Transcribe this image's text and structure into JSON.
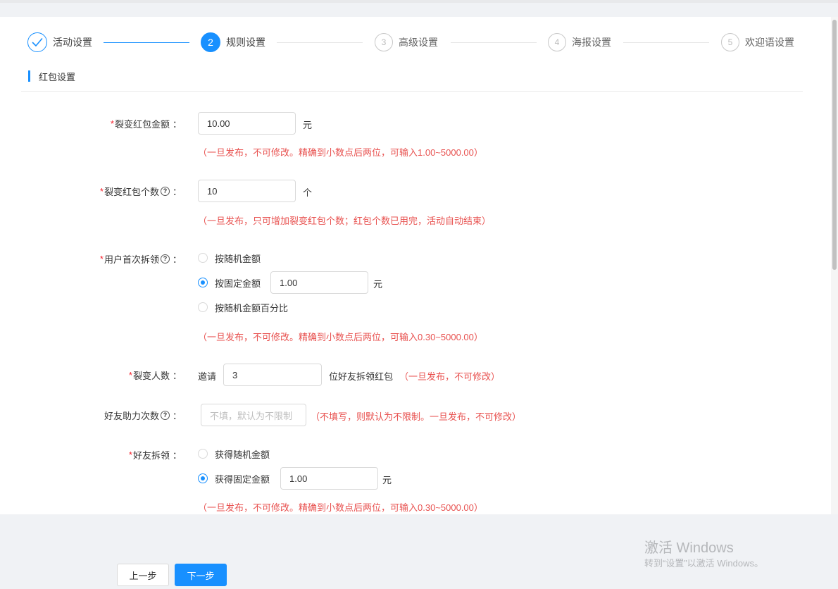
{
  "steps": [
    {
      "number": "1",
      "label": "活动设置",
      "state": "done"
    },
    {
      "number": "2",
      "label": "规则设置",
      "state": "active"
    },
    {
      "number": "3",
      "label": "高级设置",
      "state": "pending"
    },
    {
      "number": "4",
      "label": "海报设置",
      "state": "pending"
    },
    {
      "number": "5",
      "label": "欢迎语设置",
      "state": "pending"
    }
  ],
  "section": {
    "title": "红包设置"
  },
  "form": {
    "amount": {
      "label": "裂变红包金额",
      "value": "10.00",
      "unit": "元",
      "hint": "（一旦发布，不可修改。精确到小数点后两位，可输入1.00~5000.00）"
    },
    "count": {
      "label": "裂变红包个数",
      "value": "10",
      "unit": "个",
      "hint": "（一旦发布，只可增加裂变红包个数；红包个数已用完，活动自动结束）"
    },
    "first_open": {
      "label": "用户首次拆领",
      "options": [
        "按随机金额",
        "按固定金额",
        "按随机金额百分比"
      ],
      "selected": "按固定金额",
      "fixed_value": "1.00",
      "unit": "元",
      "hint": "（一旦发布，不可修改。精确到小数点后两位，可输入0.30~5000.00）"
    },
    "invite": {
      "label": "裂变人数",
      "prefix": "邀请",
      "value": "3",
      "suffix": "位好友拆领红包",
      "hint": "（一旦发布，不可修改）"
    },
    "assist": {
      "label": "好友助力次数",
      "placeholder": "不填，默认为不限制",
      "hint": "（不填写，则默认为不限制。一旦发布，不可修改）"
    },
    "friend_open": {
      "label": "好友拆领",
      "options": [
        "获得随机金额",
        "获得固定金额"
      ],
      "selected": "获得固定金额",
      "fixed_value": "1.00",
      "unit": "元",
      "hint": "（一旦发布，不可修改。精确到小数点后两位，可输入0.30~5000.00）"
    },
    "colon": "："
  },
  "footer": {
    "prev_label": "上一步",
    "next_label": "下一步"
  },
  "watermark": {
    "title": "激活 Windows",
    "subtitle": "转到“设置”以激活 Windows。"
  },
  "colors": {
    "primary": "#1890ff",
    "error_hint": "#e8514f",
    "required": "#f5222d"
  },
  "icons": {
    "step_done": "check-icon",
    "help": "question-circle-icon"
  }
}
